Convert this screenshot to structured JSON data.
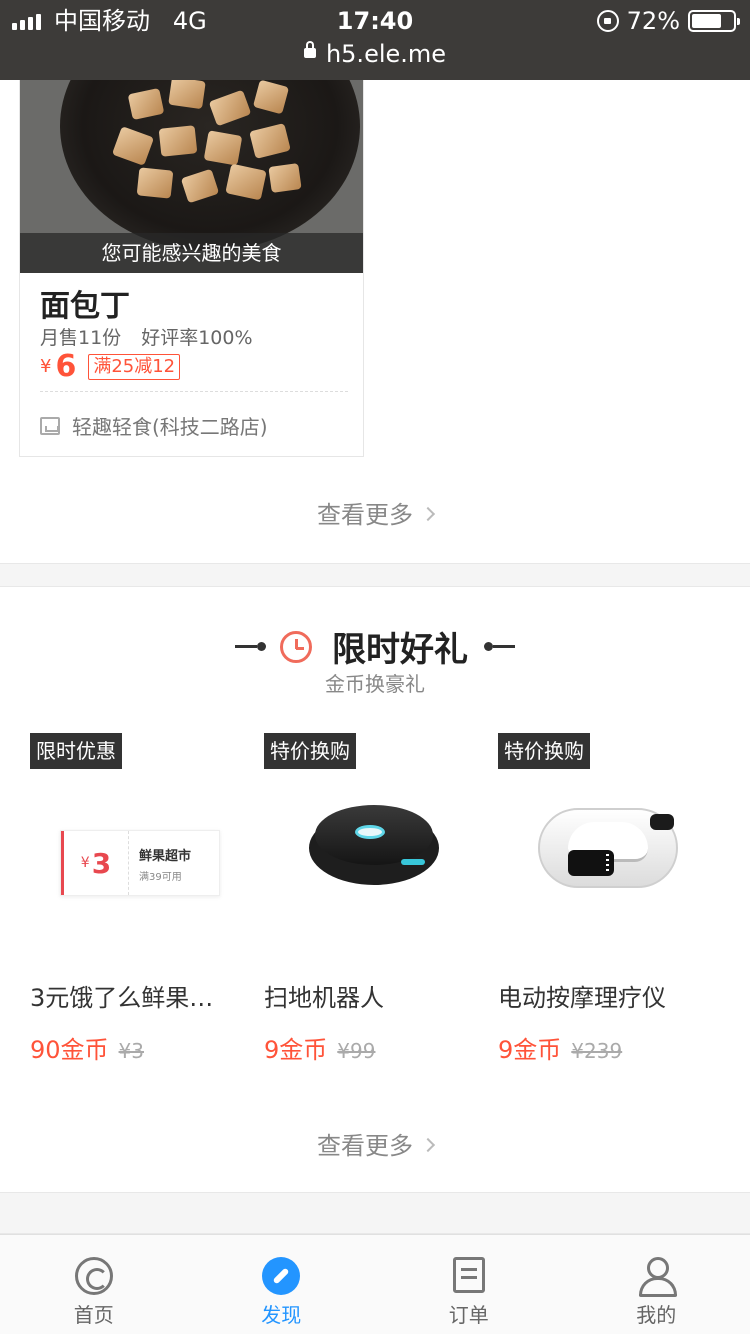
{
  "status_bar": {
    "carrier": "中国移动",
    "network": "4G",
    "time": "17:40",
    "battery": "72%",
    "battery_level": 0.72,
    "url": "h5.ele.me"
  },
  "food_card": {
    "overlay_text": "您可能感兴趣的美食",
    "name": "面包丁",
    "monthly_sales": "月售11份",
    "rating": "好评率100%",
    "currency": "¥",
    "price": "6",
    "promo": "满25减12",
    "shop": "轻趣轻食(科技二路店)"
  },
  "more_link_1": "查看更多",
  "section": {
    "title": "限时好礼",
    "subtitle": "金币换豪礼"
  },
  "gifts": [
    {
      "tag": "限时优惠",
      "name": "3元饿了么鲜果…",
      "coins": "90金币",
      "original": "¥3",
      "coupon": {
        "currency": "¥",
        "value": "3",
        "store": "鲜果超市",
        "condition": "满39可用"
      }
    },
    {
      "tag": "特价换购",
      "name": "扫地机器人",
      "coins": "9金币",
      "original": "¥99"
    },
    {
      "tag": "特价换购",
      "name": "电动按摩理疗仪",
      "coins": "9金币",
      "original": "¥239"
    }
  ],
  "more_link_2": "查看更多",
  "tabs": [
    {
      "label": "首页",
      "icon": "home-icon"
    },
    {
      "label": "发现",
      "icon": "compass-icon",
      "active": true,
      "color": "#2395ff"
    },
    {
      "label": "订单",
      "icon": "order-icon"
    },
    {
      "label": "我的",
      "icon": "user-icon"
    }
  ],
  "colors": {
    "accent": "#ff5339",
    "tab_active": "#2395ff",
    "status_bar": "#3d3b39"
  }
}
